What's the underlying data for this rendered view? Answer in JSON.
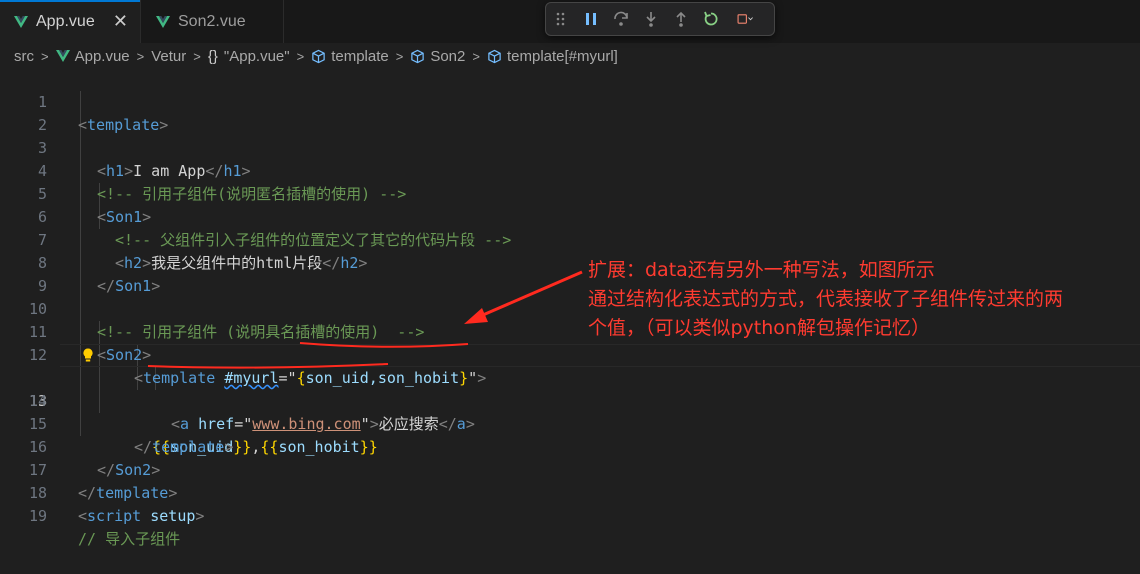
{
  "tabs": [
    {
      "label": "App.vue",
      "close": "✕",
      "active": true
    },
    {
      "label": "Son2.vue",
      "active": false
    }
  ],
  "debug_toolbar": {
    "items": [
      "drag-handle",
      "pause",
      "step-over",
      "step-into",
      "step-out",
      "restart",
      "stop"
    ]
  },
  "breadcrumb": {
    "items": [
      "src",
      "App.vue",
      "Vetur",
      "\"App.vue\"",
      "template",
      "Son2",
      "template[#myurl]"
    ],
    "curly": "{}"
  },
  "editor": {
    "current_line": 13,
    "lines": [
      {
        "n": "1"
      },
      {
        "n": "2"
      },
      {
        "n": "3"
      },
      {
        "n": "4"
      },
      {
        "n": "5"
      },
      {
        "n": "6"
      },
      {
        "n": "7"
      },
      {
        "n": "8"
      },
      {
        "n": "9"
      },
      {
        "n": "10"
      },
      {
        "n": "11"
      },
      {
        "n": "12"
      },
      {
        "n": "13"
      },
      {
        "n": "14"
      },
      {
        "n": "15"
      },
      {
        "n": "16"
      },
      {
        "n": "17"
      },
      {
        "n": "18"
      },
      {
        "n": "19"
      }
    ],
    "code": {
      "l1_tag": "template",
      "l3_tag": "h1",
      "l3_text": "I am App",
      "l4_comment": "<!-- 引用子组件(说明匿名插槽的使用) -->",
      "l5_tag": "Son1",
      "l6_comment": "<!-- 父组件引入子组件的位置定义了其它的代码片段 -->",
      "l7_tag": "h2",
      "l7_text": "我是父组件中的html片段",
      "l8_tag": "Son1",
      "l10_comment": "<!-- 引用子组件 (说明具名插槽的使用)  -->",
      "l11_tag": "Son2",
      "l12_tag": "template",
      "l12_attr": "#myurl",
      "l12_eq": "=\"",
      "l12_open": "{",
      "l12_val": "son_uid,son_hobit",
      "l12_close": "}",
      "l13_a": "{{",
      "l13_b": "son_uid",
      "l13_c": "}}",
      "l13_comma": ",",
      "l13_d": "{{",
      "l13_e": "son_hobit",
      "l13_f": "}}",
      "l14_tag": "a",
      "l14_attr": "href",
      "l14_url": "www.bing.com",
      "l14_text": "必应搜索",
      "l15_tag": "template",
      "l16_tag": "Son2",
      "l17_tag": "template",
      "l18_tag": "script",
      "l18_attr": "setup",
      "l19_comment": "// 导入子组件"
    }
  },
  "annotation": {
    "line1": "扩展：data还有另外一种写法，如图所示",
    "line2": "通过结构化表达式的方式，代表接收了子组件传过来的两",
    "line3": "个值，（可以类似python解包操作记忆）",
    "color": "#ff3b30"
  },
  "colors": {
    "tag": "#569cd6",
    "comment": "#6a9955",
    "attribute": "#9cdcfe",
    "string": "#ce9178",
    "bracket": "#ffd700",
    "active_tab_accent": "#0078d4"
  }
}
